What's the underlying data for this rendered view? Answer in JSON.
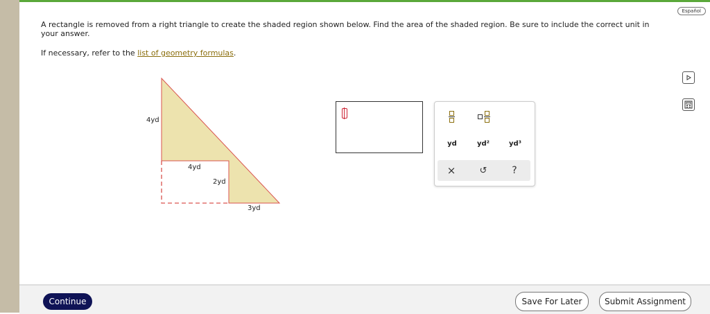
{
  "header": {
    "language_button": "Español"
  },
  "problem": {
    "statement": "A rectangle is removed from a right triangle to create the shaded region shown below. Find the area of the shaded region. Be sure to include the correct unit in your answer.",
    "refer_prefix": "If necessary, refer to the ",
    "refer_link": "list of geometry formulas",
    "refer_suffix": "."
  },
  "figure": {
    "labels": {
      "left_side": "4yd",
      "rect_width": "4yd",
      "rect_height": "2yd",
      "bottom": "3yd"
    },
    "shade_color": "#ede3ae",
    "outline_color": "#d9534f"
  },
  "answer": {
    "value": ""
  },
  "keypad": {
    "units": [
      "yd",
      "yd²",
      "yd³"
    ],
    "actions": {
      "clear": "×",
      "undo": "↺",
      "help": "?"
    }
  },
  "footer": {
    "continue": "Continue",
    "save": "Save For Later",
    "submit": "Submit Assignment"
  },
  "colors": {
    "primary": "#0f1356",
    "accent_green": "#5aa83a",
    "link": "#8a6d0b"
  }
}
